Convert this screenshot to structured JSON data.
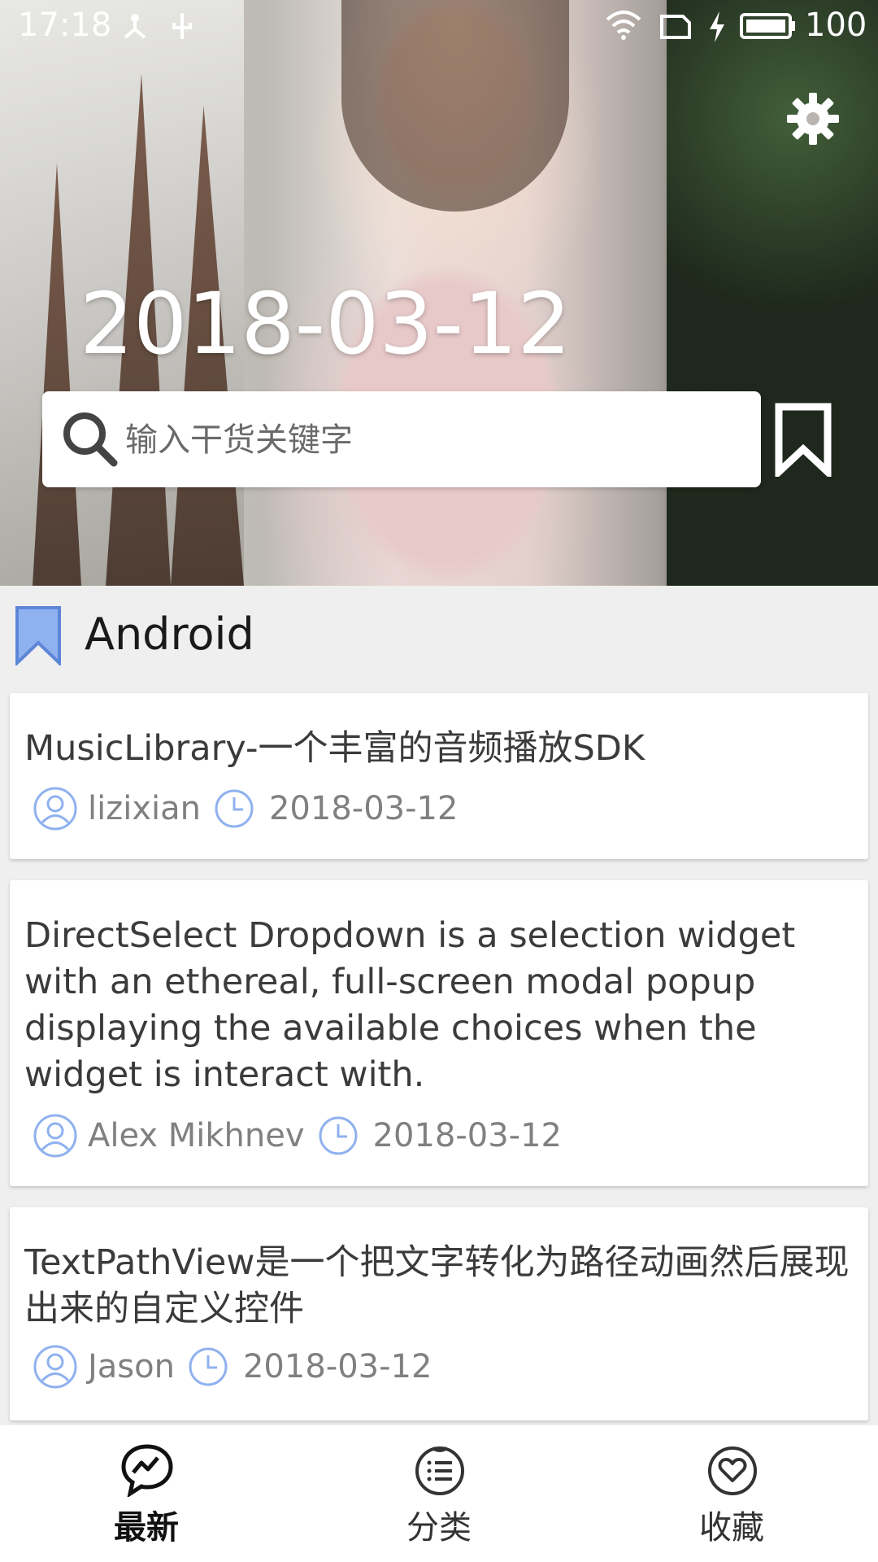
{
  "status_bar": {
    "time": "17:18",
    "battery_level": "100"
  },
  "header": {
    "date": "2018-03-12",
    "search_placeholder": "输入干货关键字"
  },
  "section": {
    "title": "Android"
  },
  "articles": [
    {
      "title": "MusicLibrary-一个丰富的音频播放SDK",
      "author": "lizixian",
      "date": "2018-03-12"
    },
    {
      "title": "DirectSelect Dropdown is a selection widget with an ethereal, full-screen modal popup displaying the available choices when the widget is interact with.",
      "author": "Alex Mikhnev",
      "date": "2018-03-12"
    },
    {
      "title": "TextPathView是一个把文字转化为路径动画然后展现出来的自定义控件",
      "author": "Jason",
      "date": "2018-03-12"
    }
  ],
  "bottom_nav": [
    {
      "label": "最新",
      "icon": "trend-chat-icon",
      "active": true
    },
    {
      "label": "分类",
      "icon": "list-icon",
      "active": false
    },
    {
      "label": "收藏",
      "icon": "heart-icon",
      "active": false
    }
  ],
  "colors": {
    "accent_blue": "#7ea2e8",
    "card_text": "#3b3b3b",
    "meta_text": "#808080"
  }
}
